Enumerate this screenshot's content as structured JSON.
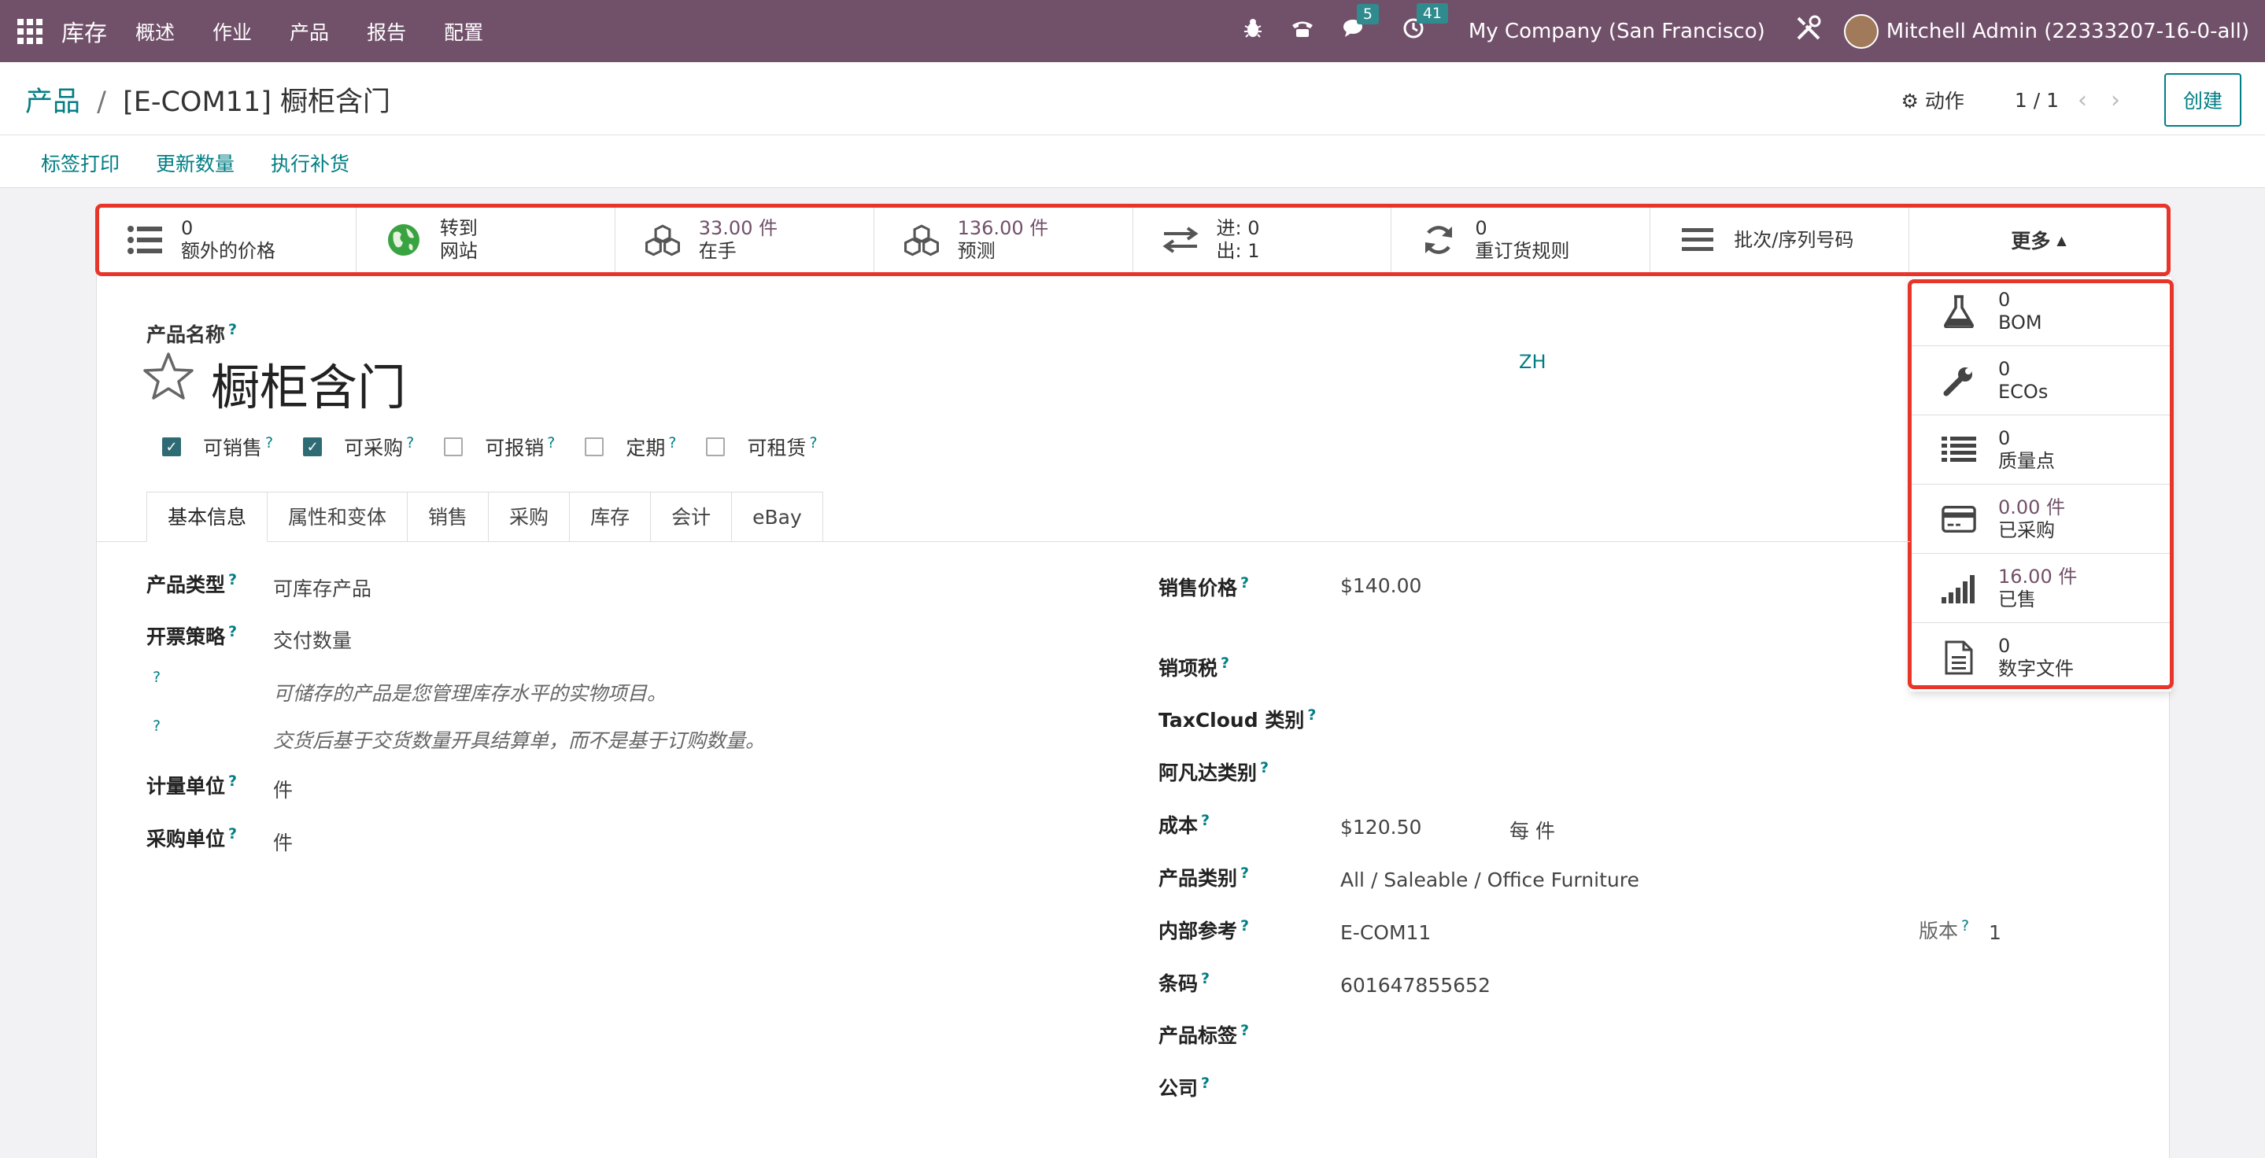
{
  "navbar": {
    "brand": "库存",
    "menu": [
      "概述",
      "作业",
      "产品",
      "报告",
      "配置"
    ],
    "chat_count": "5",
    "activity_count": "41",
    "company": "My Company (San Francisco)",
    "user": "Mitchell Admin (22333207-16-0-all)"
  },
  "control": {
    "breadcrumb_parent": "产品",
    "breadcrumb_sep": "/",
    "breadcrumb_current": "[E-COM11] 橱柜含门",
    "action_label": "动作",
    "pager": "1 / 1",
    "create_label": "创建",
    "buttons": [
      "标签打印",
      "更新数量",
      "执行补货"
    ]
  },
  "stats": [
    {
      "icon": "list-icon",
      "value": "0",
      "label": "额外的价格"
    },
    {
      "icon": "globe-icon",
      "value": "转到",
      "label": "网站"
    },
    {
      "icon": "cubes-icon",
      "value": "33.00 件",
      "label": "在手"
    },
    {
      "icon": "cubes-icon",
      "value": "136.00 件",
      "label": "预测"
    },
    {
      "icon": "exchange-icon",
      "value": "进: 0",
      "label": "出: 1"
    },
    {
      "icon": "refresh-icon",
      "value": "0",
      "label": "重订货规则"
    },
    {
      "icon": "bars-icon",
      "value": "",
      "label": "批次/序列号码"
    }
  ],
  "more_label": "更多",
  "dropdown": [
    {
      "icon": "flask-icon",
      "value": "0",
      "label": "BOM"
    },
    {
      "icon": "wrench-icon",
      "value": "0",
      "label": "ECOs"
    },
    {
      "icon": "list-icon",
      "value": "0",
      "label": "质量点"
    },
    {
      "icon": "credit-card-icon",
      "value": "0.00 件",
      "label": "已采购"
    },
    {
      "icon": "signal-icon",
      "value": "16.00 件",
      "label": "已售"
    },
    {
      "icon": "file-icon",
      "value": "0",
      "label": "数字文件"
    }
  ],
  "form": {
    "name_label": "产品名称",
    "title": "橱柜含门",
    "lang": "ZH",
    "checkboxes": [
      {
        "label": "可销售",
        "checked": true
      },
      {
        "label": "可采购",
        "checked": true
      },
      {
        "label": "可报销",
        "checked": false
      },
      {
        "label": "定期",
        "checked": false
      },
      {
        "label": "可租赁",
        "checked": false
      }
    ],
    "tabs": [
      "基本信息",
      "属性和变体",
      "销售",
      "采购",
      "库存",
      "会计",
      "eBay"
    ],
    "left": {
      "type_label": "产品类型",
      "type_value": "可库存产品",
      "invoice_label": "开票策略",
      "invoice_value": "交付数量",
      "note1": "可储存的产品是您管理库存水平的实物项目。",
      "note2": "交货后基于交货数量开具结算单，而不是基于订购数量。",
      "uom_label": "计量单位",
      "uom_value": "件",
      "po_uom_label": "采购单位",
      "po_uom_value": "件"
    },
    "right": {
      "price_label": "销售价格",
      "price_value": "$140.00",
      "tax_label": "销项税",
      "taxcloud_label": "TaxCloud 类别",
      "avatax_label": "阿凡达类别",
      "cost_label": "成本",
      "cost_value": "$120.50",
      "cost_unit": "每 件",
      "categ_label": "产品类别",
      "categ_value": "All / Saleable / Office Furniture",
      "ref_label": "内部参考",
      "ref_value": "E-COM11",
      "version_label": "版本",
      "version_value": "1",
      "barcode_label": "条码",
      "barcode_value": "601647855652",
      "tags_label": "产品标签",
      "company_label": "公司"
    }
  }
}
